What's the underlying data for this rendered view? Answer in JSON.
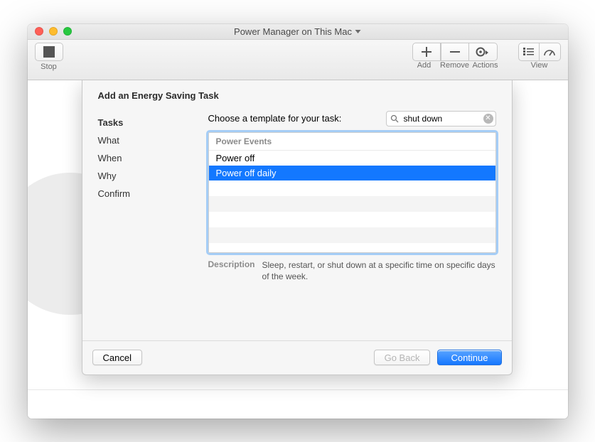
{
  "window": {
    "title": "Power Manager on This Mac"
  },
  "toolbar": {
    "stop": "Stop",
    "add": "Add",
    "remove": "Remove",
    "actions": "Actions",
    "view": "View"
  },
  "sheet": {
    "title": "Add an Energy Saving Task",
    "steps": {
      "tasks": "Tasks",
      "what": "What",
      "when": "When",
      "why": "Why",
      "confirm": "Confirm"
    },
    "prompt": "Choose a template for your task:",
    "search": {
      "value": "shut down"
    },
    "list": {
      "group": "Power Events",
      "items": {
        "power_off": "Power off",
        "power_off_daily": "Power off daily"
      }
    },
    "description_label": "Description",
    "description": "Sleep, restart, or shut down at a specific time on specific days of the week.",
    "buttons": {
      "cancel": "Cancel",
      "back": "Go Back",
      "continue": "Continue"
    }
  }
}
